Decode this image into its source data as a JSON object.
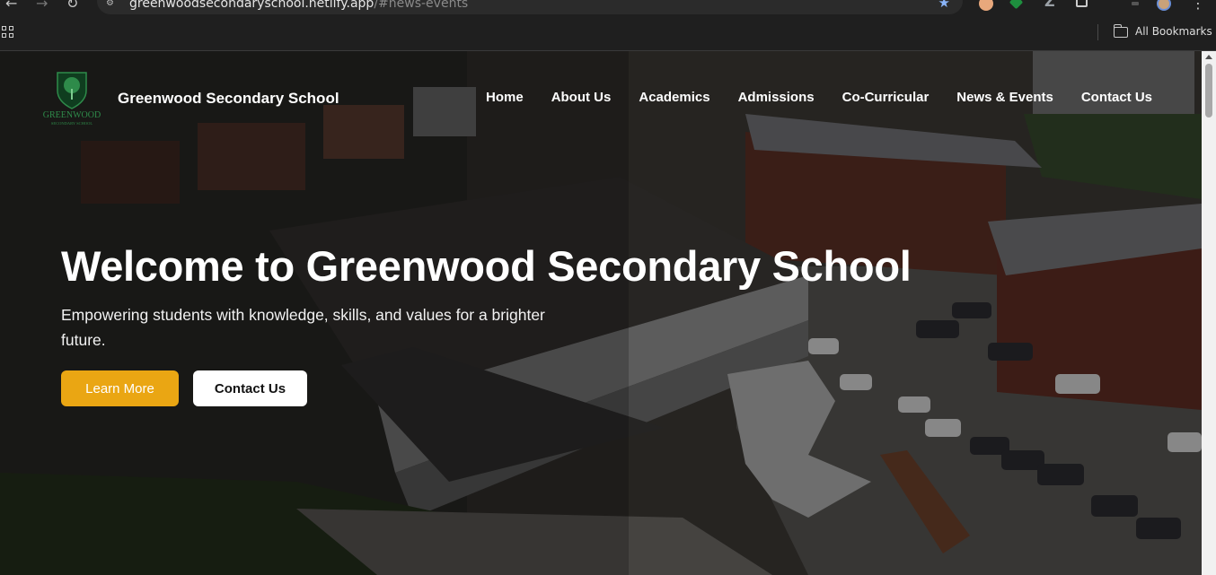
{
  "browser": {
    "url_host": "greenwoodsecondaryschool.netlify.app",
    "url_fragment": "/#news-events",
    "bookmarks_label": "All Bookmarks"
  },
  "header": {
    "logo_text_main": "GREENWOOD",
    "logo_text_sub": "SECONDARY SCHOOL",
    "site_title": "Greenwood Secondary School"
  },
  "nav": {
    "items": [
      "Home",
      "About Us",
      "Academics",
      "Admissions",
      "Co-Curricular",
      "News & Events",
      "Contact Us"
    ]
  },
  "hero": {
    "title": "Welcome to Greenwood Secondary School",
    "subtitle": "Empowering students with knowledge, skills, and values for a brighter future.",
    "primary_button": "Learn More",
    "secondary_button": "Contact Us"
  },
  "colors": {
    "accent": "#eaa613",
    "logo_green": "#1f6b35"
  },
  "icons": {
    "back": "back-arrow-icon",
    "forward": "forward-arrow-icon",
    "reload": "reload-icon",
    "bookmark": "star-icon",
    "apps": "apps-grid-icon",
    "folder": "folder-icon"
  }
}
